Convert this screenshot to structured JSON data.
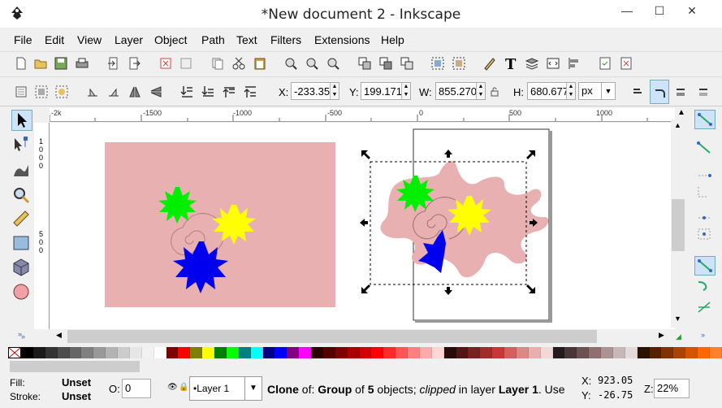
{
  "window": {
    "title": "*New document 2 - Inkscape",
    "minimize": "—",
    "maximize": "☐",
    "close": "✕"
  },
  "menubar": [
    "File",
    "Edit",
    "View",
    "Layer",
    "Object",
    "Path",
    "Text",
    "Filters",
    "Extensions",
    "Help"
  ],
  "toolbar2": {
    "x_label": "X:",
    "x_value": "-233.35",
    "y_label": "Y:",
    "y_value": "199.171",
    "w_label": "W:",
    "w_value": "855.270",
    "h_label": "H:",
    "h_value": "680.677",
    "unit": "px"
  },
  "ruler": {
    "h_ticks": [
      "-2k",
      "-1500",
      "-1000",
      "-500",
      "0",
      "500",
      "1000"
    ],
    "v_ticks": [
      "1 0 0 0",
      "5 0 0"
    ]
  },
  "statusbar": {
    "fill_label": "Fill:",
    "fill_value": "Unset",
    "stroke_label": "Stroke:",
    "stroke_value": "Unset",
    "opacity_label": "O:",
    "opacity_value": "0",
    "layer": "•Layer 1",
    "msg_clone": "Clone",
    "msg_of": " of: ",
    "msg_group": "Group",
    "msg_of5": " of ",
    "msg_count": "5",
    "msg_objects": " objects; ",
    "msg_clipped": "clipped",
    "msg_in": " in layer ",
    "msg_layer": "Layer 1",
    "msg_use": ". Use",
    "x_label": "X:",
    "x_coord": "923.05",
    "y_label": "Y:",
    "y_coord": "-26.75",
    "z_label": "Z:",
    "zoom": "22%"
  },
  "colors": {
    "pink": "#e8b0b0",
    "green": "#00ee00",
    "yellow": "#ffff00",
    "blue": "#0000ee",
    "accent": "#cde3f7"
  },
  "palette": [
    "#000000",
    "#1a1a1a",
    "#333333",
    "#4d4d4d",
    "#666666",
    "#808080",
    "#999999",
    "#b3b3b3",
    "#cccccc",
    "#e6e6e6",
    "#f2f2f2",
    "#ffffff",
    "#800000",
    "#ff0000",
    "#808000",
    "#ffff00",
    "#008000",
    "#00ff00",
    "#008080",
    "#00ffff",
    "#000080",
    "#0000ff",
    "#800080",
    "#ff00ff",
    "#2b0000",
    "#550000",
    "#800000",
    "#aa0000",
    "#d40000",
    "#ff0000",
    "#ff2a2a",
    "#ff5555",
    "#ff8080",
    "#ffaaaa",
    "#ffd5d5",
    "#280b0b",
    "#501616",
    "#782121",
    "#a02c2c",
    "#c83737",
    "#d35f5f",
    "#de8787",
    "#e9afaf",
    "#f4d7d7",
    "#241c1c",
    "#483737",
    "#6c5353",
    "#916f6f",
    "#ac9393",
    "#c8b7b7",
    "#e3dbdb",
    "#2b1100",
    "#552200",
    "#803300",
    "#aa4400",
    "#d45500",
    "#ff6600",
    "#ff7f2a"
  ]
}
